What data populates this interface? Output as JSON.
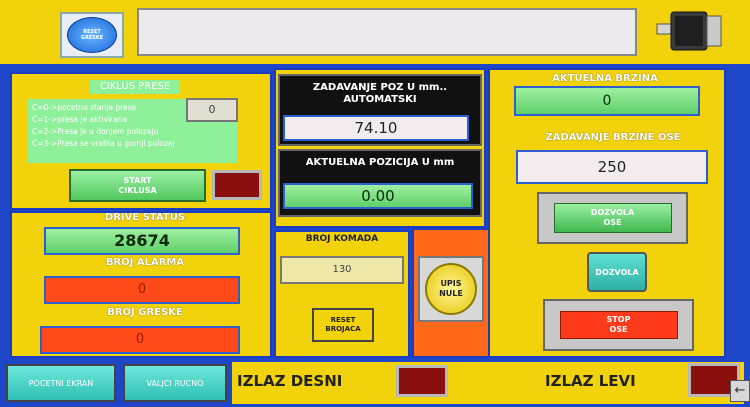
{
  "header": {
    "reset_errors_label": "RESET GRESKE",
    "message_text": ""
  },
  "ciklus": {
    "title": "CIKLUS PRESE",
    "legend": [
      "C=0->pocetno stanje prese",
      "C=1->presa je aktivirana",
      "C=2->Presa je u donjem polozaju",
      "C=3->Presa se vratila u gornji polozaj"
    ],
    "value": "0",
    "start_label": "START CIKLUSA"
  },
  "drive": {
    "status_label": "DRIVE STATUS",
    "status_value": "28674",
    "alarm_label": "BROJ ALARMA",
    "alarm_value": "0",
    "error_label": "BROJ GRESKE",
    "error_value": "0"
  },
  "position": {
    "set_label": "ZADAVANJE POZ U mm.. AUTOMATSKI",
    "set_value": "74.10",
    "actual_label": "AKTUELNA POZICIJA U mm",
    "actual_value": "0.00"
  },
  "pieces": {
    "label": "BROJ KOMADA",
    "value": "130",
    "reset_label": "RESET BROJACA"
  },
  "upis_label": "UPIS NULE",
  "speed": {
    "actual_label": "AKTUELNA BRZINA",
    "actual_value": "0",
    "set_label": "ZADAVANJE BRZINE OSE",
    "set_value": "250",
    "enable_axis_label": "DOZVOLA OSE",
    "enable_label": "DOZVOLA",
    "stop_label": "STOP OSE"
  },
  "footer": {
    "home_label": "POCETNI EKRAN",
    "rollers_label": "VALJCI RUCNO",
    "exit_right_label": "IZLAZ DESNI",
    "exit_left_label": "IZLAZ LEVI"
  },
  "colors": {
    "panel_yellow": "#f2d20a",
    "frame_blue": "#1e46c8",
    "field_green": "#6fdc78",
    "field_red": "#ff4a1a",
    "button_teal": "#4fd6c8"
  }
}
